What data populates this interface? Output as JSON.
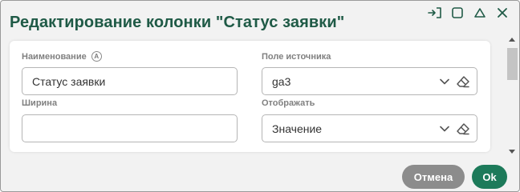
{
  "dialog": {
    "title": "Редактирование колонки \"Статус заявки\""
  },
  "window_controls": [
    {
      "name": "exit-icon"
    },
    {
      "name": "maximize-icon"
    },
    {
      "name": "collapse-icon"
    },
    {
      "name": "close-icon"
    }
  ],
  "form": {
    "name_label": "Наименование",
    "name_info_badge": "A",
    "name_value": "Статус заявки",
    "source_label": "Поле источника",
    "source_value": "ga3",
    "width_label": "Ширина",
    "width_value": "",
    "display_label": "Отображать",
    "display_value": "Значение"
  },
  "buttons": {
    "cancel_label": "Отмена",
    "ok_label": "Ok"
  },
  "colors": {
    "title": "#1f5a46",
    "ok_button": "#1d7a5a",
    "cancel_button": "#8c8c8c"
  }
}
